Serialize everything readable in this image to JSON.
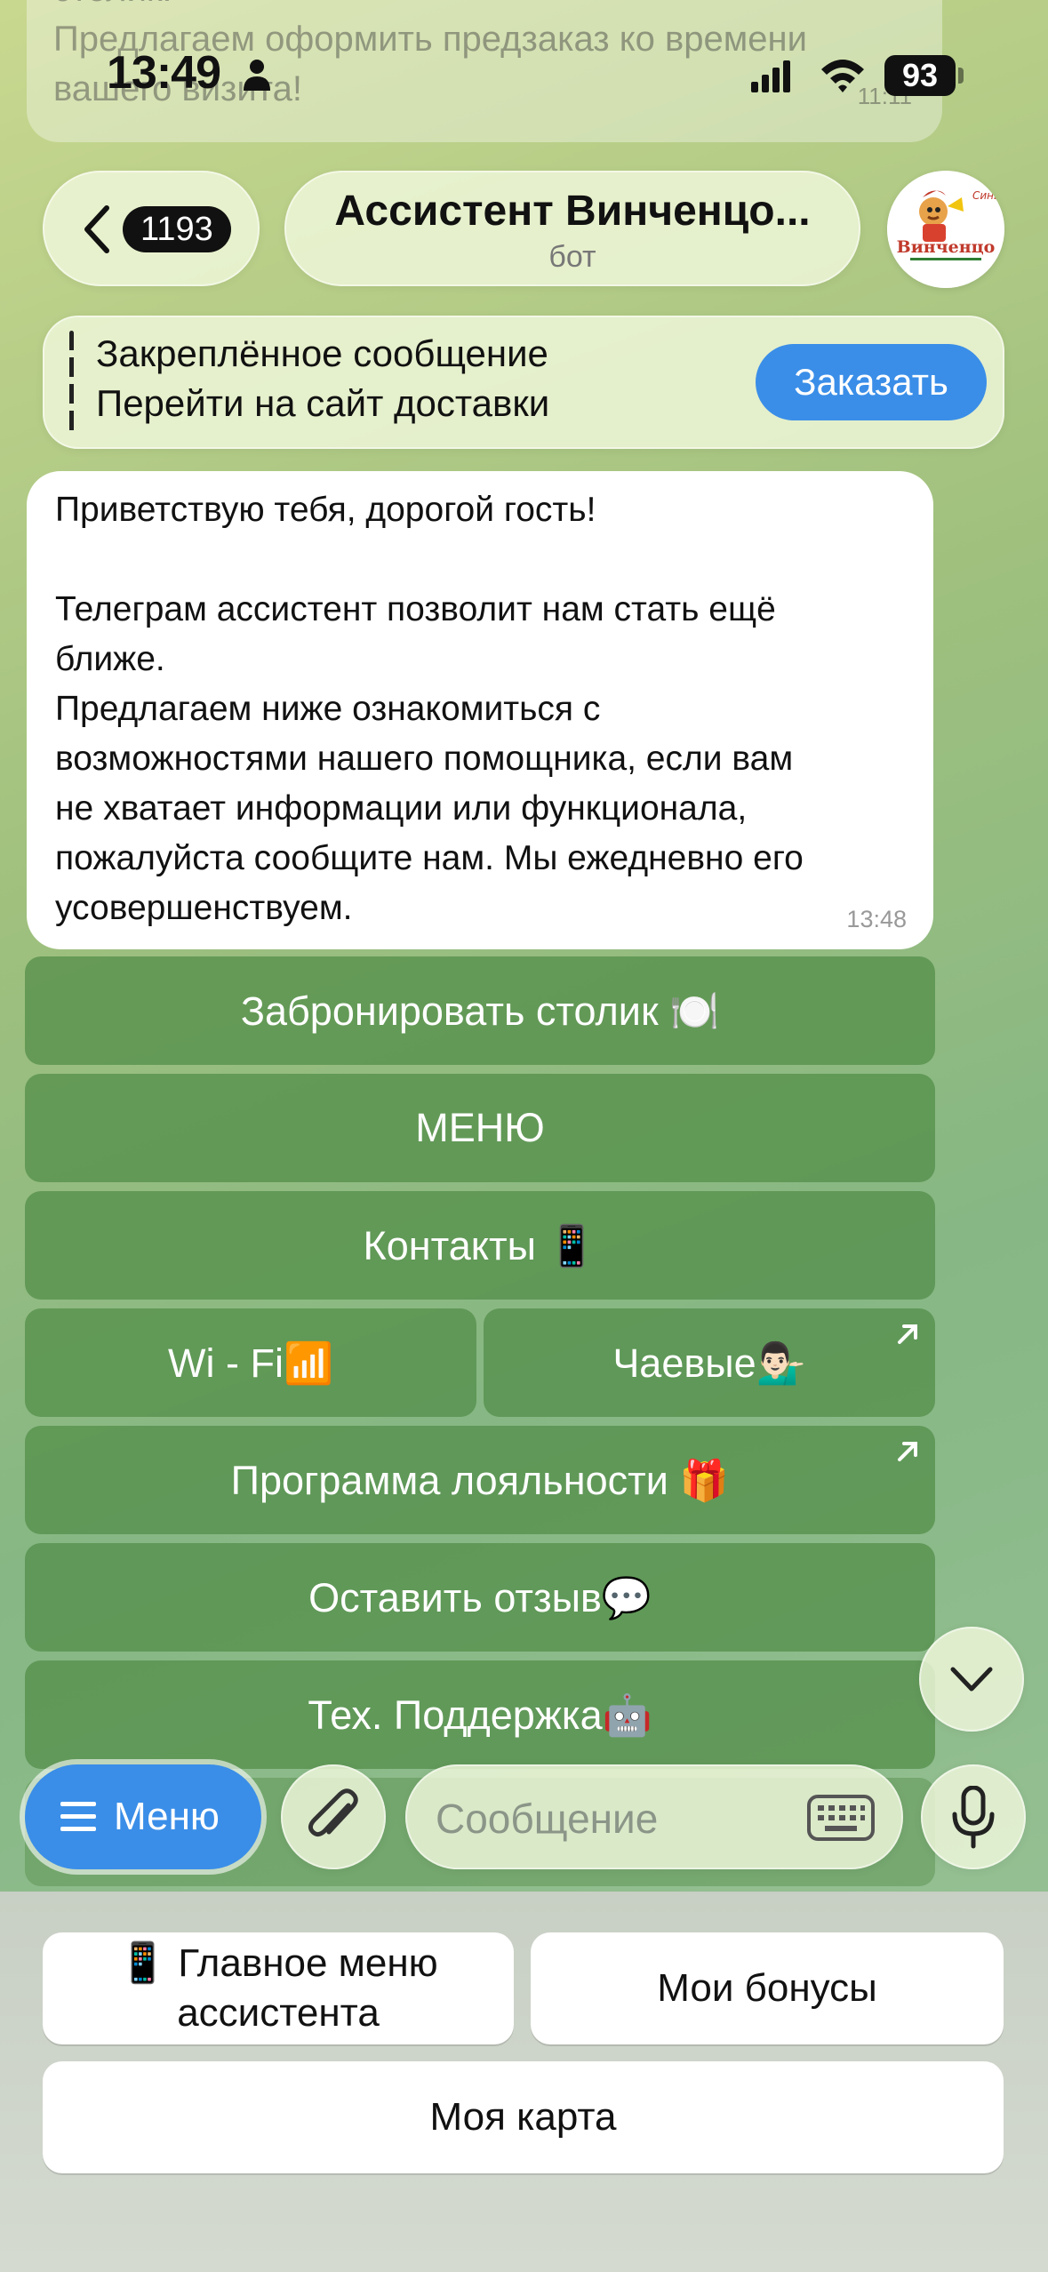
{
  "previous_message": {
    "line1": "столик.",
    "line2": "Предлагаем оформить предзаказ ко времени",
    "line3": "вашего визита!",
    "time": "11:11"
  },
  "status_bar": {
    "time": "13:49",
    "battery": "93"
  },
  "header": {
    "back_count": "1193",
    "title": "Ассистент Винченцо...",
    "subtitle": "бот"
  },
  "pinned": {
    "title": "Закреплённое сообщение",
    "text": "Перейти на сайт доставки",
    "button": "Заказать"
  },
  "message": {
    "lines": [
      "Приветствую тебя, дорогой гость!",
      "",
      "Телеграм ассистент позволит нам стать ещё",
      "ближе.",
      "Предлагаем ниже ознакомиться с",
      "возможностями нашего помощника, если вам",
      "не хватает информации или функционала,",
      "пожалуйста сообщите нам. Мы ежедневно его",
      "усовершенствуем."
    ],
    "time": "13:48"
  },
  "inline_keyboard": {
    "book_table": "Забронировать столик 🍽️",
    "menu": "МЕНЮ",
    "contacts": "Контакты 📱",
    "wifi": "Wi - Fi📶",
    "tips": "Чаевые💁🏻‍♂️",
    "loyalty": "Программа лояльности 🎁",
    "review": "Оставить отзыв💬",
    "support": "Тех. Поддержка🤖"
  },
  "input_bar": {
    "menu_label": "Меню",
    "placeholder": "Сообщение"
  },
  "reply_keyboard": {
    "main_menu_line1": "📱 Главное меню",
    "main_menu_line2": "ассистента",
    "bonuses": "Мои бонусы",
    "my_card": "Моя карта"
  },
  "colors": {
    "accent_blue": "#3a8ee8",
    "inline_button": "#5a9a4e",
    "panel": "#ced4ca"
  }
}
